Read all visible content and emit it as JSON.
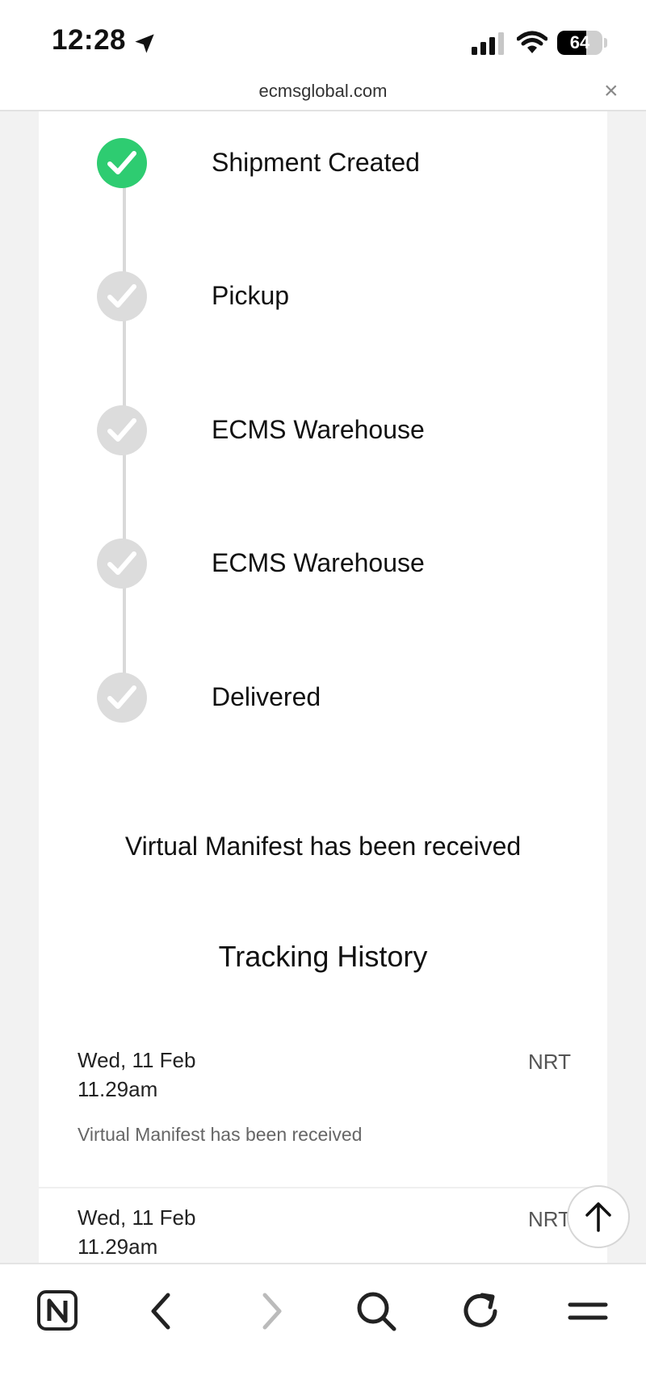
{
  "status_bar": {
    "time": "12:28",
    "battery": "64",
    "battery_level": 0.64
  },
  "browser": {
    "url": "ecmsglobal.com",
    "close": "×"
  },
  "timeline": {
    "steps": [
      {
        "label": "Shipment Created",
        "done": true
      },
      {
        "label": "Pickup",
        "done": false
      },
      {
        "label": "ECMS Warehouse",
        "done": false
      },
      {
        "label": "ECMS Warehouse",
        "done": false
      },
      {
        "label": "Delivered",
        "done": false
      }
    ]
  },
  "status_message": "Virtual Manifest has been received",
  "history": {
    "title": "Tracking History",
    "entries": [
      {
        "date": "Wed, 11 Feb",
        "time": "11.29am",
        "location": "NRT",
        "description": "Virtual Manifest has been received"
      },
      {
        "date": "Wed, 11 Feb",
        "time": "11.29am",
        "location": "NRT",
        "description": ""
      }
    ]
  },
  "colors": {
    "done": "#2ecc71",
    "pending": "#dcdcdc"
  },
  "toolbar": {
    "icons": [
      "n-logo-icon",
      "back-icon",
      "forward-icon",
      "search-icon",
      "reload-icon",
      "menu-icon"
    ]
  }
}
